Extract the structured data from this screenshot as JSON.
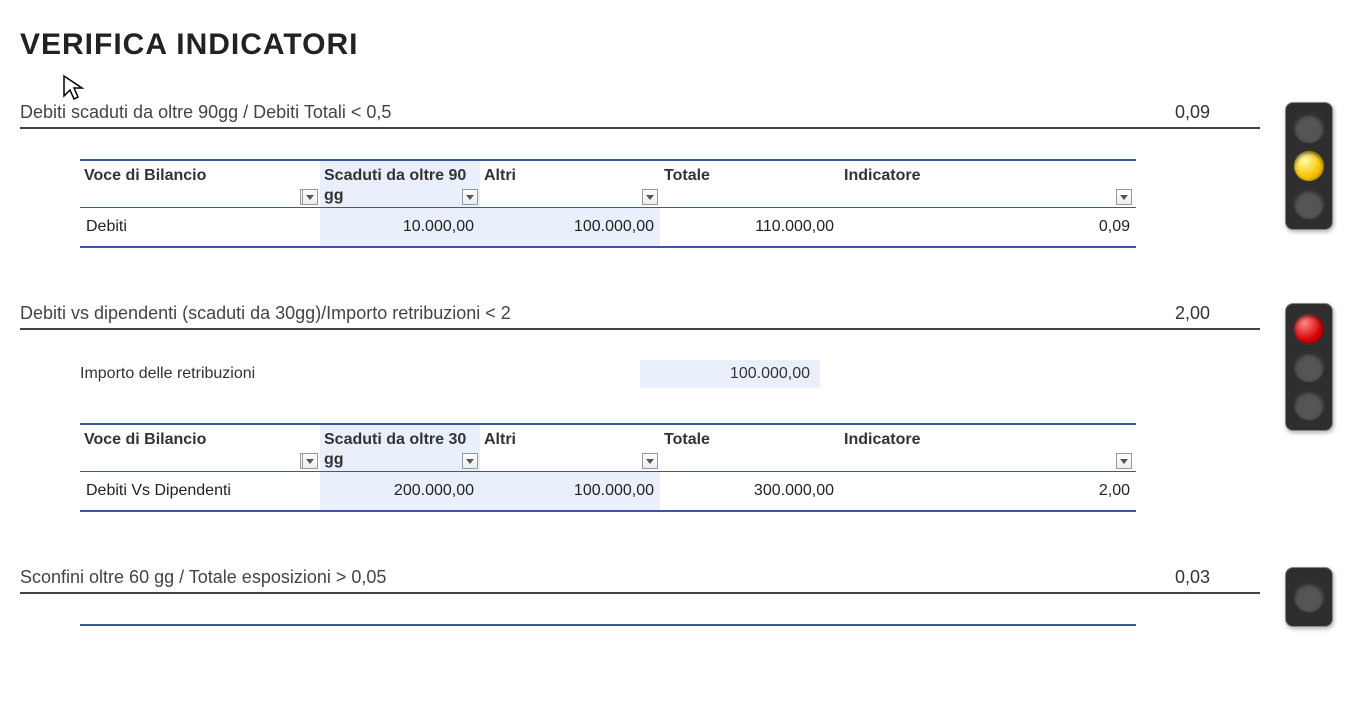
{
  "page_title": "VERIFICA INDICATORI",
  "sections": [
    {
      "title": "Debiti scaduti da oltre 90gg / Debiti Totali < 0,5",
      "value": "0,09",
      "light": "yellow",
      "subrow": null,
      "table": {
        "headers": [
          "Voce di Bilancio",
          "Scaduti da oltre 90 gg",
          "Altri",
          "Totale",
          "Indicatore"
        ],
        "row": {
          "voce": "Debiti",
          "scaduti": "10.000,00",
          "altri": "100.000,00",
          "totale": "110.000,00",
          "indicatore": "0,09"
        }
      }
    },
    {
      "title": "Debiti vs dipendenti (scaduti da 30gg)/Importo retribuzioni < 2",
      "value": "2,00",
      "light": "red",
      "subrow": {
        "label": "Importo delle retribuzioni",
        "value": "100.000,00"
      },
      "table": {
        "headers": [
          "Voce di Bilancio",
          "Scaduti da oltre 30 gg",
          "Altri",
          "Totale",
          "Indicatore"
        ],
        "row": {
          "voce": "Debiti Vs Dipendenti",
          "scaduti": "200.000,00",
          "altri": "100.000,00",
          "totale": "300.000,00",
          "indicatore": "2,00"
        }
      }
    },
    {
      "title": "Sconfini oltre 60 gg / Totale esposizioni > 0,05",
      "value": "0,03",
      "light": "yellow",
      "subrow": null,
      "table": null
    }
  ]
}
